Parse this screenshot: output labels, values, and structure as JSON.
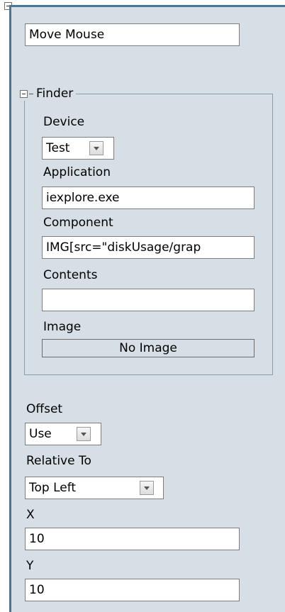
{
  "action": {
    "name_value": "Move Mouse"
  },
  "finder": {
    "legend": "Finder",
    "device_label": "Device",
    "device_value": "Test",
    "application_label": "Application",
    "application_value": "iexplore.exe",
    "component_label": "Component",
    "component_value": "IMG[src=\"diskUsage/grap",
    "contents_label": "Contents",
    "contents_value": "",
    "image_label": "Image",
    "image_value": "No Image"
  },
  "offset": {
    "label": "Offset",
    "value": "Use",
    "relative_label": "Relative To",
    "relative_value": "Top Left",
    "x_label": "X",
    "x_value": "10",
    "y_label": "Y",
    "y_value": "10"
  },
  "colors": {
    "panel_bg": "#d5dfe5",
    "border_accent": "#49769b"
  }
}
